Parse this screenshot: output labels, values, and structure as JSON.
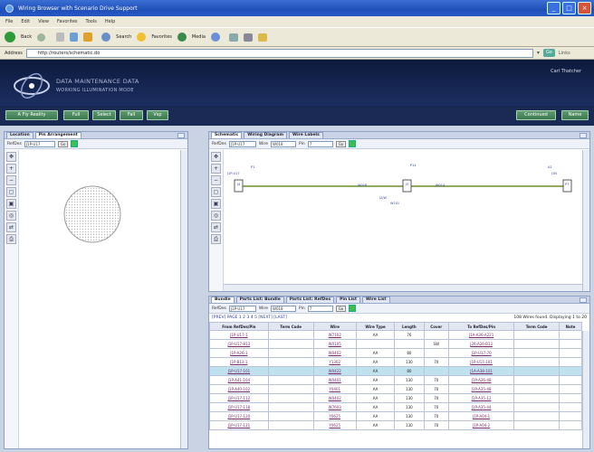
{
  "window": {
    "title": "Wiring Browser with Scenario Drive Support"
  },
  "menu": [
    "File",
    "Edit",
    "View",
    "Favorites",
    "Tools",
    "Help"
  ],
  "toolbar": {
    "back": "Back",
    "search": "Search",
    "favorites": "Favorites",
    "media": "Media"
  },
  "address": {
    "label": "Address",
    "url": "http://routers/schematic.do",
    "go": "Go",
    "links": "Links"
  },
  "app": {
    "title": "DATA MAINTENANCE DATA",
    "subtitle": "WORKING ILLUMINATION MODE",
    "user": "Carl Thatcher",
    "nav": [
      "A Fly Reality",
      "Full",
      "Select",
      "Fall",
      "Vsp"
    ],
    "nav_right": [
      "Continued",
      "Name"
    ]
  },
  "left_panel": {
    "tabs": [
      "Location",
      "Pin Arrangement"
    ],
    "filter": {
      "label": "RefDes",
      "value": "J1P-U17",
      "go": "Go"
    }
  },
  "schematic_panel": {
    "tabs": [
      "Schematic",
      "Wiring Diagram",
      "Wire Labels"
    ],
    "filter": {
      "label1": "RefDes",
      "value1": "J1P-U17",
      "label2": "Wire",
      "value2": "W018",
      "label3": "Pin",
      "value3": "7",
      "go": "Go"
    },
    "labels": [
      "J1P-U17",
      "P1",
      "J4",
      "W018",
      "J2/W",
      "P14",
      "J3",
      "W014",
      "W101",
      "A1",
      "J1N",
      "P7"
    ]
  },
  "bottom_panel": {
    "tabs": [
      "Bundle",
      "Parts List: Bundle",
      "Parts List: RefDes",
      "Pin List",
      "Wire List"
    ],
    "filter": {
      "label1": "RefDes",
      "value1": "J1P-U17",
      "label2": "Wire",
      "value2": "W018",
      "label3": "Pin",
      "value3": "7",
      "go": "Go"
    },
    "pager": "[PREV] PAGE 1 2 3 4 5 [NEXT] [LAST]",
    "count": "108 Wires found. Displaying 1 to 20",
    "columns": [
      "From RefDes/Pin",
      "Term Code",
      "Wire",
      "Wire Type",
      "Length",
      "Cover",
      "To RefDes/Pin",
      "Term Code",
      "Note"
    ],
    "rows": [
      [
        "J1P-U17-1",
        "",
        "W7102",
        "AA",
        "76",
        "",
        "J1A-A36-A221",
        "",
        ""
      ],
      [
        "J1P-U17-B13",
        "",
        "W0105",
        "",
        "",
        "SW",
        "J2R-A26-B13",
        "",
        ""
      ],
      [
        "J1P-A26-1",
        "",
        "W0402",
        "AA",
        "80",
        "",
        "J1P-U17-70",
        "",
        ""
      ],
      [
        "J1P-B13-1",
        "",
        "Y1302",
        "AA",
        "130",
        "70",
        "J1P-U17-101",
        "",
        ""
      ],
      [
        "J1P-U17-101",
        "",
        "W0422",
        "AA",
        "80",
        "",
        "J1A-A38-101",
        "",
        ""
      ],
      [
        "J1P-A41-104",
        "",
        "W0401",
        "AA",
        "130",
        "70",
        "J1P-A26-48",
        "",
        ""
      ],
      [
        "J1P-A40-102",
        "",
        "Y0401",
        "AA",
        "130",
        "70",
        "J1P-A35-48",
        "",
        ""
      ],
      [
        "J1P-U17-112",
        "",
        "W0402",
        "AA",
        "130",
        "70",
        "J1P-A35-12",
        "",
        ""
      ],
      [
        "J1P-U17-118",
        "",
        "W7603",
        "AA",
        "130",
        "70",
        "J1P-A35-44",
        "",
        ""
      ],
      [
        "J1P-U17-120",
        "",
        "Y0625",
        "AA",
        "130",
        "70",
        "J1P-A04-1",
        "",
        ""
      ],
      [
        "J1P-U17-121",
        "",
        "Y0625",
        "AA",
        "130",
        "70",
        "J1P-A04-2",
        "",
        ""
      ]
    ]
  },
  "colors": {
    "header": "#0c1a3c",
    "nav_button": "#4e8a5f",
    "selected_row": "#bfe2ee",
    "link": "#7a2a6a"
  }
}
